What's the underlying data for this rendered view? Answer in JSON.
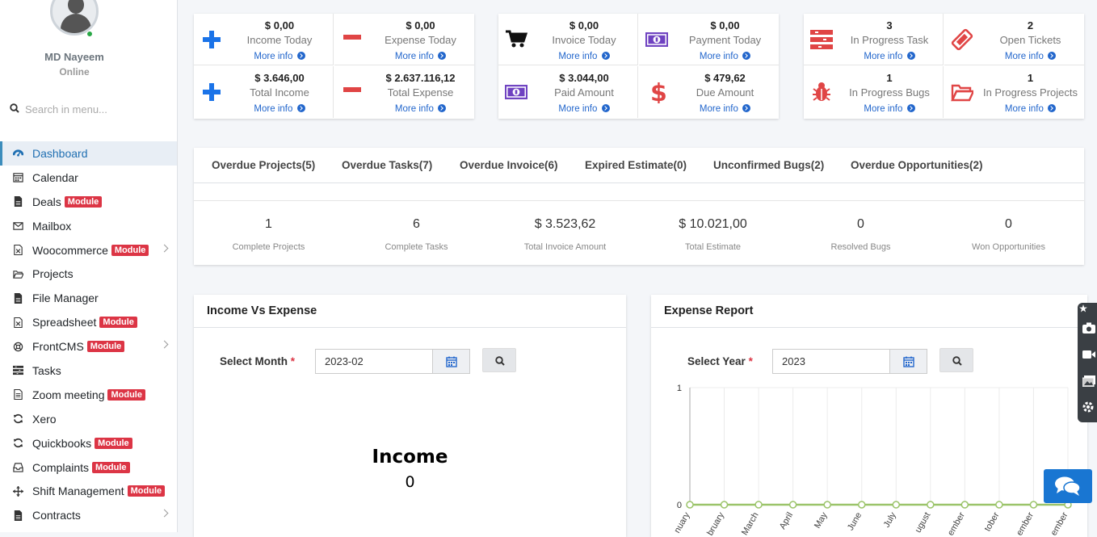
{
  "user": {
    "name": "MD Nayeem",
    "status": "Online"
  },
  "search": {
    "placeholder": "Search in menu..."
  },
  "nav": [
    {
      "label": "Dashboard",
      "icon": "dashboard-icon"
    },
    {
      "label": "Calendar",
      "icon": "calendar-icon"
    },
    {
      "label": "Deals",
      "icon": "file-icon",
      "badge": "Module"
    },
    {
      "label": "Mailbox",
      "icon": "envelope-icon"
    },
    {
      "label": "Woocommerce",
      "icon": "file-excel-icon",
      "badge": "Module"
    },
    {
      "label": "Projects",
      "icon": "folder-open-icon"
    },
    {
      "label": "File Manager",
      "icon": "file-icon"
    },
    {
      "label": "Spreadsheet",
      "icon": "file-excel-icon",
      "badge": "Module"
    },
    {
      "label": "FrontCMS",
      "icon": "life-ring-icon",
      "badge": "Module"
    },
    {
      "label": "Tasks",
      "icon": "tasks-icon"
    },
    {
      "label": "Zoom meeting",
      "icon": "file-text-icon",
      "badge": "Module"
    },
    {
      "label": "Xero",
      "icon": "refresh-icon"
    },
    {
      "label": "Quickbooks",
      "icon": "refresh-icon",
      "badge": "Module"
    },
    {
      "label": "Complaints",
      "icon": "inbox-icon",
      "badge": "Module"
    },
    {
      "label": "Shift Management",
      "icon": "arrows-icon",
      "badge": "Module"
    },
    {
      "label": "Contracts",
      "icon": "file-icon"
    }
  ],
  "stats": [
    {
      "value": "$ 0,00",
      "label": "Income Today",
      "icon": "plus-icon",
      "color": "#1a73e8"
    },
    {
      "value": "$ 0,00",
      "label": "Expense Today",
      "icon": "minus-icon",
      "color": "#e04545"
    },
    {
      "value": "$ 3.646,00",
      "label": "Total Income",
      "icon": "plus-icon",
      "color": "#1a73e8"
    },
    {
      "value": "$ 2.637.116,12",
      "label": "Total Expense",
      "icon": "minus-icon",
      "color": "#e04545"
    },
    {
      "value": "$ 0,00",
      "label": "Invoice Today",
      "icon": "cart-icon",
      "color": "#111111"
    },
    {
      "value": "$ 0,00",
      "label": "Payment Today",
      "icon": "money-icon",
      "color": "#6f42c1"
    },
    {
      "value": "$ 3.044,00",
      "label": "Paid Amount",
      "icon": "money-icon",
      "color": "#6f42c1"
    },
    {
      "value": "$ 479,62",
      "label": "Due Amount",
      "icon": "dollar-icon",
      "color": "#e04545"
    },
    {
      "value": "3",
      "label": "In Progress Task",
      "icon": "tasks-icon",
      "color": "#e04545"
    },
    {
      "value": "2",
      "label": "Open Tickets",
      "icon": "ticket-icon",
      "color": "#e04545"
    },
    {
      "value": "1",
      "label": "In Progress Bugs",
      "icon": "bug-icon",
      "color": "#e04545"
    },
    {
      "value": "1",
      "label": "In Progress Projects",
      "icon": "folder-open-icon",
      "color": "#e04545"
    }
  ],
  "more_info": "More info",
  "overdue_tabs": [
    "Overdue Projects(5)",
    "Overdue Tasks(7)",
    "Overdue Invoice(6)",
    "Expired Estimate(0)",
    "Unconfirmed Bugs(2)",
    "Overdue Opportunities(2)"
  ],
  "summary": [
    {
      "value": "1",
      "caption": "Complete Projects"
    },
    {
      "value": "6",
      "caption": "Complete Tasks"
    },
    {
      "value": "$ 3.523,62",
      "caption": "Total Invoice Amount"
    },
    {
      "value": "$ 10.021,00",
      "caption": "Total Estimate"
    },
    {
      "value": "0",
      "caption": "Resolved Bugs"
    },
    {
      "value": "0",
      "caption": "Won Opportunities"
    }
  ],
  "income_vs_expense": {
    "title": "Income Vs Expense",
    "label": "Select Month",
    "required": "*",
    "value": "2023-02",
    "chart_title": "Income",
    "chart_value": "0"
  },
  "expense_report": {
    "title": "Expense Report",
    "label": "Select Year",
    "required": "*",
    "value": "2023"
  },
  "chart_data": {
    "type": "line",
    "categories": [
      "January",
      "February",
      "March",
      "April",
      "May",
      "June",
      "July",
      "August",
      "September",
      "October",
      "November",
      "December"
    ],
    "visible_tick_labels": [
      "nuary",
      "bruary",
      "March",
      "April",
      "May",
      "June",
      "July",
      "ugust",
      "ember",
      "tober",
      "ember",
      "ember"
    ],
    "values": [
      0,
      0,
      0,
      0,
      0,
      0,
      0,
      0,
      0,
      0,
      0,
      0
    ],
    "ylim": [
      0,
      1
    ],
    "y_ticks": [
      "0",
      "1"
    ],
    "series_color": "#9bc46a",
    "grid": true
  },
  "colors": {
    "accent": "#3c8dbc",
    "badge": "#dc3545",
    "link": "#2266cc"
  }
}
